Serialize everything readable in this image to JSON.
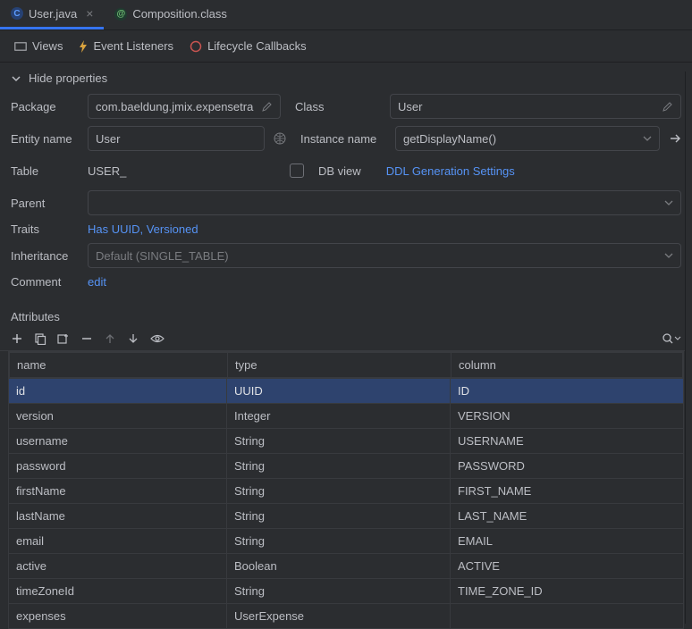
{
  "tabs": [
    {
      "label": "User.java",
      "iconLetter": "C",
      "active": true
    },
    {
      "label": "Composition.class",
      "iconLetter": "@",
      "active": false
    }
  ],
  "subtabs": {
    "views": "Views",
    "listeners": "Event Listeners",
    "lifecycle": "Lifecycle Callbacks"
  },
  "collapse": "Hide properties",
  "form": {
    "labels": {
      "package": "Package",
      "class": "Class",
      "entityName": "Entity name",
      "instanceName": "Instance name",
      "table": "Table",
      "dbView": "DB view",
      "parent": "Parent",
      "traits": "Traits",
      "inheritance": "Inheritance",
      "comment": "Comment"
    },
    "values": {
      "package": "com.baeldung.jmix.expensetra",
      "class": "User",
      "entityName": "User",
      "instanceName": "getDisplayName()",
      "table": "USER_",
      "ddlLink": "DDL Generation Settings",
      "traits": "Has UUID, Versioned",
      "inheritance": "Default (SINGLE_TABLE)",
      "commentAction": "edit"
    }
  },
  "attributes": {
    "title": "Attributes",
    "columns": {
      "name": "name",
      "type": "type",
      "column": "column"
    },
    "rows": [
      {
        "name": "id",
        "type": "UUID",
        "column": "ID",
        "selected": true
      },
      {
        "name": "version",
        "type": "Integer",
        "column": "VERSION"
      },
      {
        "name": "username",
        "type": "String",
        "column": "USERNAME"
      },
      {
        "name": "password",
        "type": "String",
        "column": "PASSWORD"
      },
      {
        "name": "firstName",
        "type": "String",
        "column": "FIRST_NAME"
      },
      {
        "name": "lastName",
        "type": "String",
        "column": "LAST_NAME"
      },
      {
        "name": "email",
        "type": "String",
        "column": "EMAIL"
      },
      {
        "name": "active",
        "type": "Boolean",
        "column": "ACTIVE"
      },
      {
        "name": "timeZoneId",
        "type": "String",
        "column": "TIME_ZONE_ID"
      },
      {
        "name": "expenses",
        "type": "UserExpense",
        "column": ""
      }
    ]
  }
}
